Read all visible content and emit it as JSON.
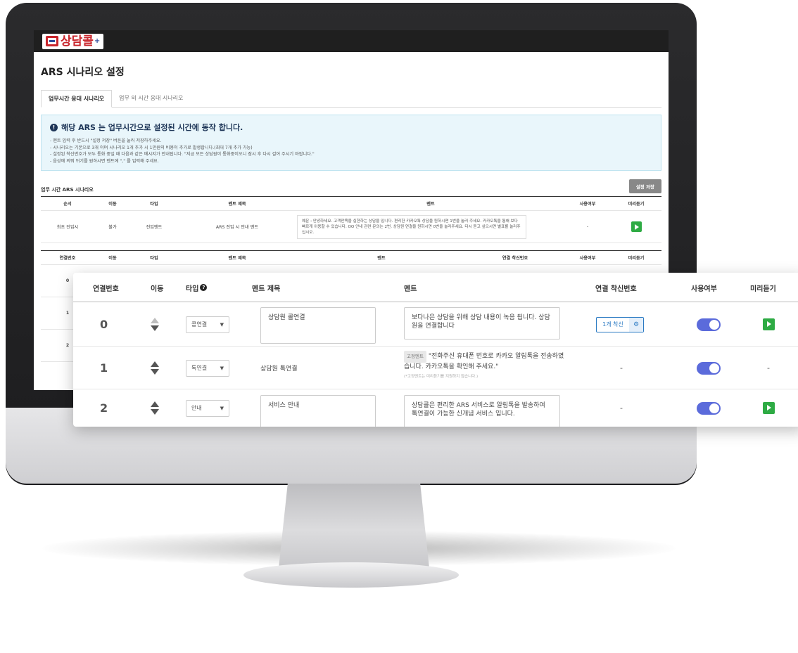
{
  "app": {
    "logo_text": "상담콜",
    "logo_plus": "+",
    "page_title": "ARS 시나리오 설정"
  },
  "tabs": [
    {
      "label": "업무시간 응대 시나리오",
      "active": true
    },
    {
      "label": "업무 외 시간 응대 시나리오",
      "active": false
    }
  ],
  "notice": {
    "title": "해당 ARS 는 업무시간으로 설정된 시간에 동작 합니다.",
    "lines": [
      "- 멘트 입력 후 반드시 \"설정 저장\" 버튼을 눌러 저장하주세요.",
      "- 시나리오는 기본으로 3개 이며 시나리오 1개 추가 시 1만원의 비용이 추가로 발생합니다.(최대 7개 추가 가능)",
      "- 설정된 착신번호가 모두 통화 중일 때 다음과 같은 메시지가 안내됩니다. \"지금 모든 상담원이 통화중이오니 잠시 후 다시 걸어 주시기 바랍니다.\"",
      "- 음성에 의뭐 뒤기를 원하시면 멘트에 \",\" 를 입력해 주세요."
    ]
  },
  "section": {
    "title": "업무 시간 ARS 시나리오",
    "save_label": "설정 저장"
  },
  "intro_table": {
    "headers": [
      "순서",
      "이동",
      "타입",
      "멘트 제목",
      "멘트",
      "사용여부",
      "미리듣기"
    ],
    "row": {
      "order": "최초 진입시",
      "move": "불가",
      "type": "진입멘트",
      "title": "ARS 진입 시 안내 멘트",
      "ment": "예문 : 안녕하세요. 고객만족을 실현하는 상담을 입니다. 편리한 카카오톡 상담을 원하시면 1번을 눌러 주세요. 카카오톡을 통해 보다 빠르게 이용할 수 있습니다. OO 안내 관련 문의는 2번, 상담원 연결을 원하시면 0번을 눌러주세요. 다시 듣고 싶으시면 별표를 눌러주십시오.",
      "use": "-"
    }
  },
  "scenario_headers": {
    "num": "연결번호",
    "move": "이동",
    "type": "타입",
    "title": "멘트 제목",
    "ment": "멘트",
    "forward": "연결 착신번호",
    "use": "사용여부",
    "preview": "미리듣기"
  },
  "scenarios": [
    {
      "num": "0",
      "type": "콜연결",
      "title": "상담원 콜연결",
      "ment": "보다나은 상담을 위해 상담 내용이 녹음 됩니다. 상담원을 연결합니다",
      "forward": "1개 착신",
      "use_on": true,
      "preview": "play"
    },
    {
      "num": "1",
      "type": "톡연결",
      "title": "상담원 톡연결",
      "fixed_tag": "고정멘트",
      "ment": "\"전화주신 휴대폰 번호로 카카오 알림톡을 전송하였습니다. 카카오톡을 확인해 주세요.\"",
      "note": "(*고정멘트는 미리듣기를 지원하지 않습니다.)",
      "forward": "-",
      "use_on": true,
      "preview": "-"
    },
    {
      "num": "2",
      "type": "안내",
      "title": "서비스 안내",
      "ment": "상담콜은 편리한 ARS 서비스로 알림톡을 발송하여 톡연결이 가능한 신개념 서비스 입니다.",
      "forward": "-",
      "use_on": true,
      "preview": "play"
    }
  ],
  "colors": {
    "brand_red": "#c9252c",
    "brand_blue": "#2c4a9b",
    "toggle_on": "#5b6bdb",
    "play_green": "#2eab44",
    "notice_bg": "#e9f6fb"
  }
}
